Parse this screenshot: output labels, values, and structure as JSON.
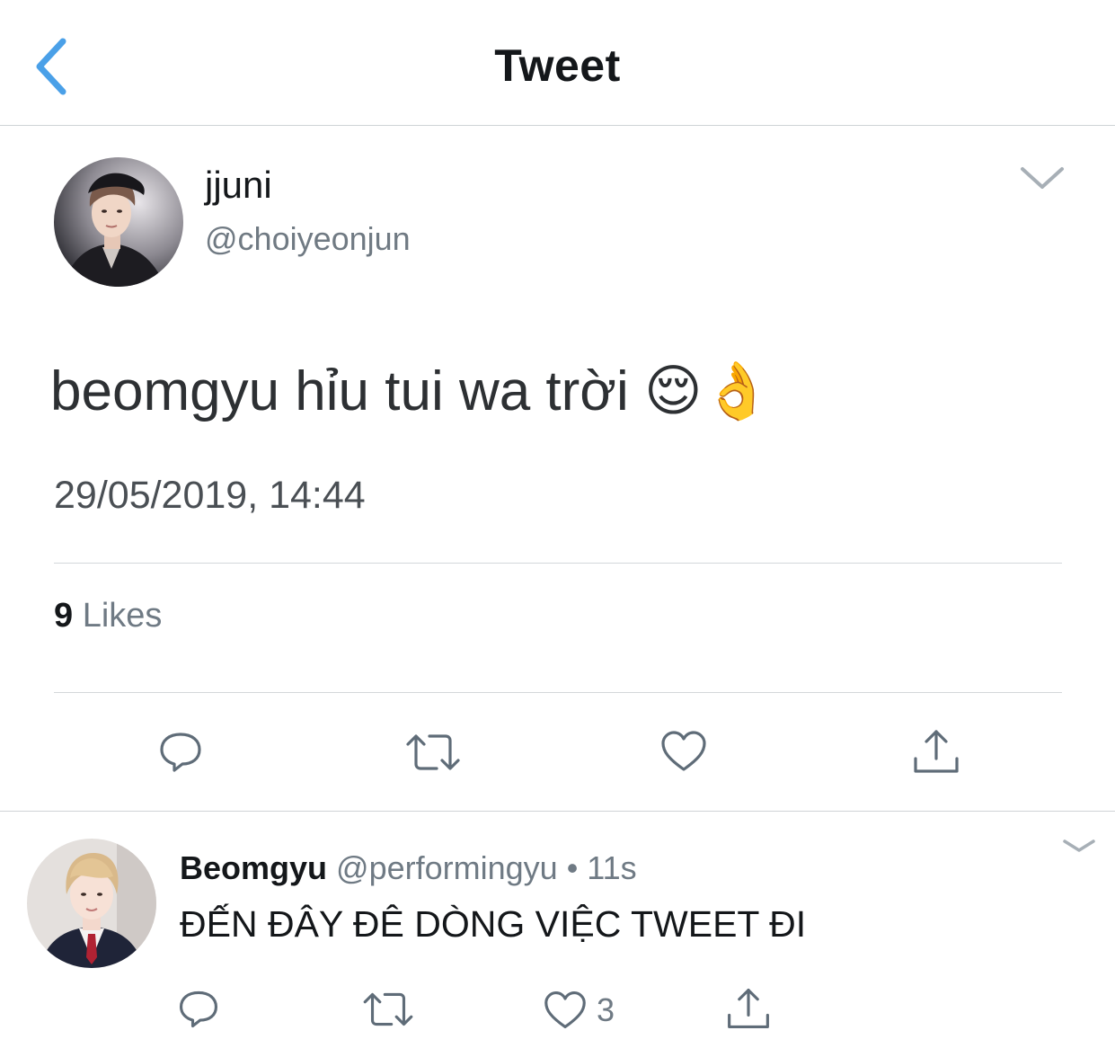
{
  "header": {
    "title": "Tweet",
    "back_icon": "chevron-left-icon"
  },
  "tweet": {
    "author": {
      "display_name": "jjuni",
      "handle": "@choiyeonjun"
    },
    "text": "beomgyu hỉu tui wa trời 😌👌",
    "timestamp": "29/05/2019, 14:44",
    "likes": {
      "count": "9",
      "label": "Likes"
    },
    "actions": [
      "reply-icon",
      "retweet-icon",
      "like-icon",
      "share-icon"
    ]
  },
  "reply": {
    "author": {
      "display_name": "Beomgyu",
      "handle_time": "@performingyu • 11s"
    },
    "text": "ĐẾN ĐÂY ĐÊ DÒNG VIỆC TWEET ĐI",
    "like_count": "3",
    "actions": [
      "reply-icon",
      "retweet-icon",
      "like-icon",
      "share-icon"
    ]
  },
  "colors": {
    "accent": "#4aa0e8",
    "icon_gray": "#5f6c78",
    "divider": "#d3d7da",
    "secondary_text": "#6f7a84"
  }
}
